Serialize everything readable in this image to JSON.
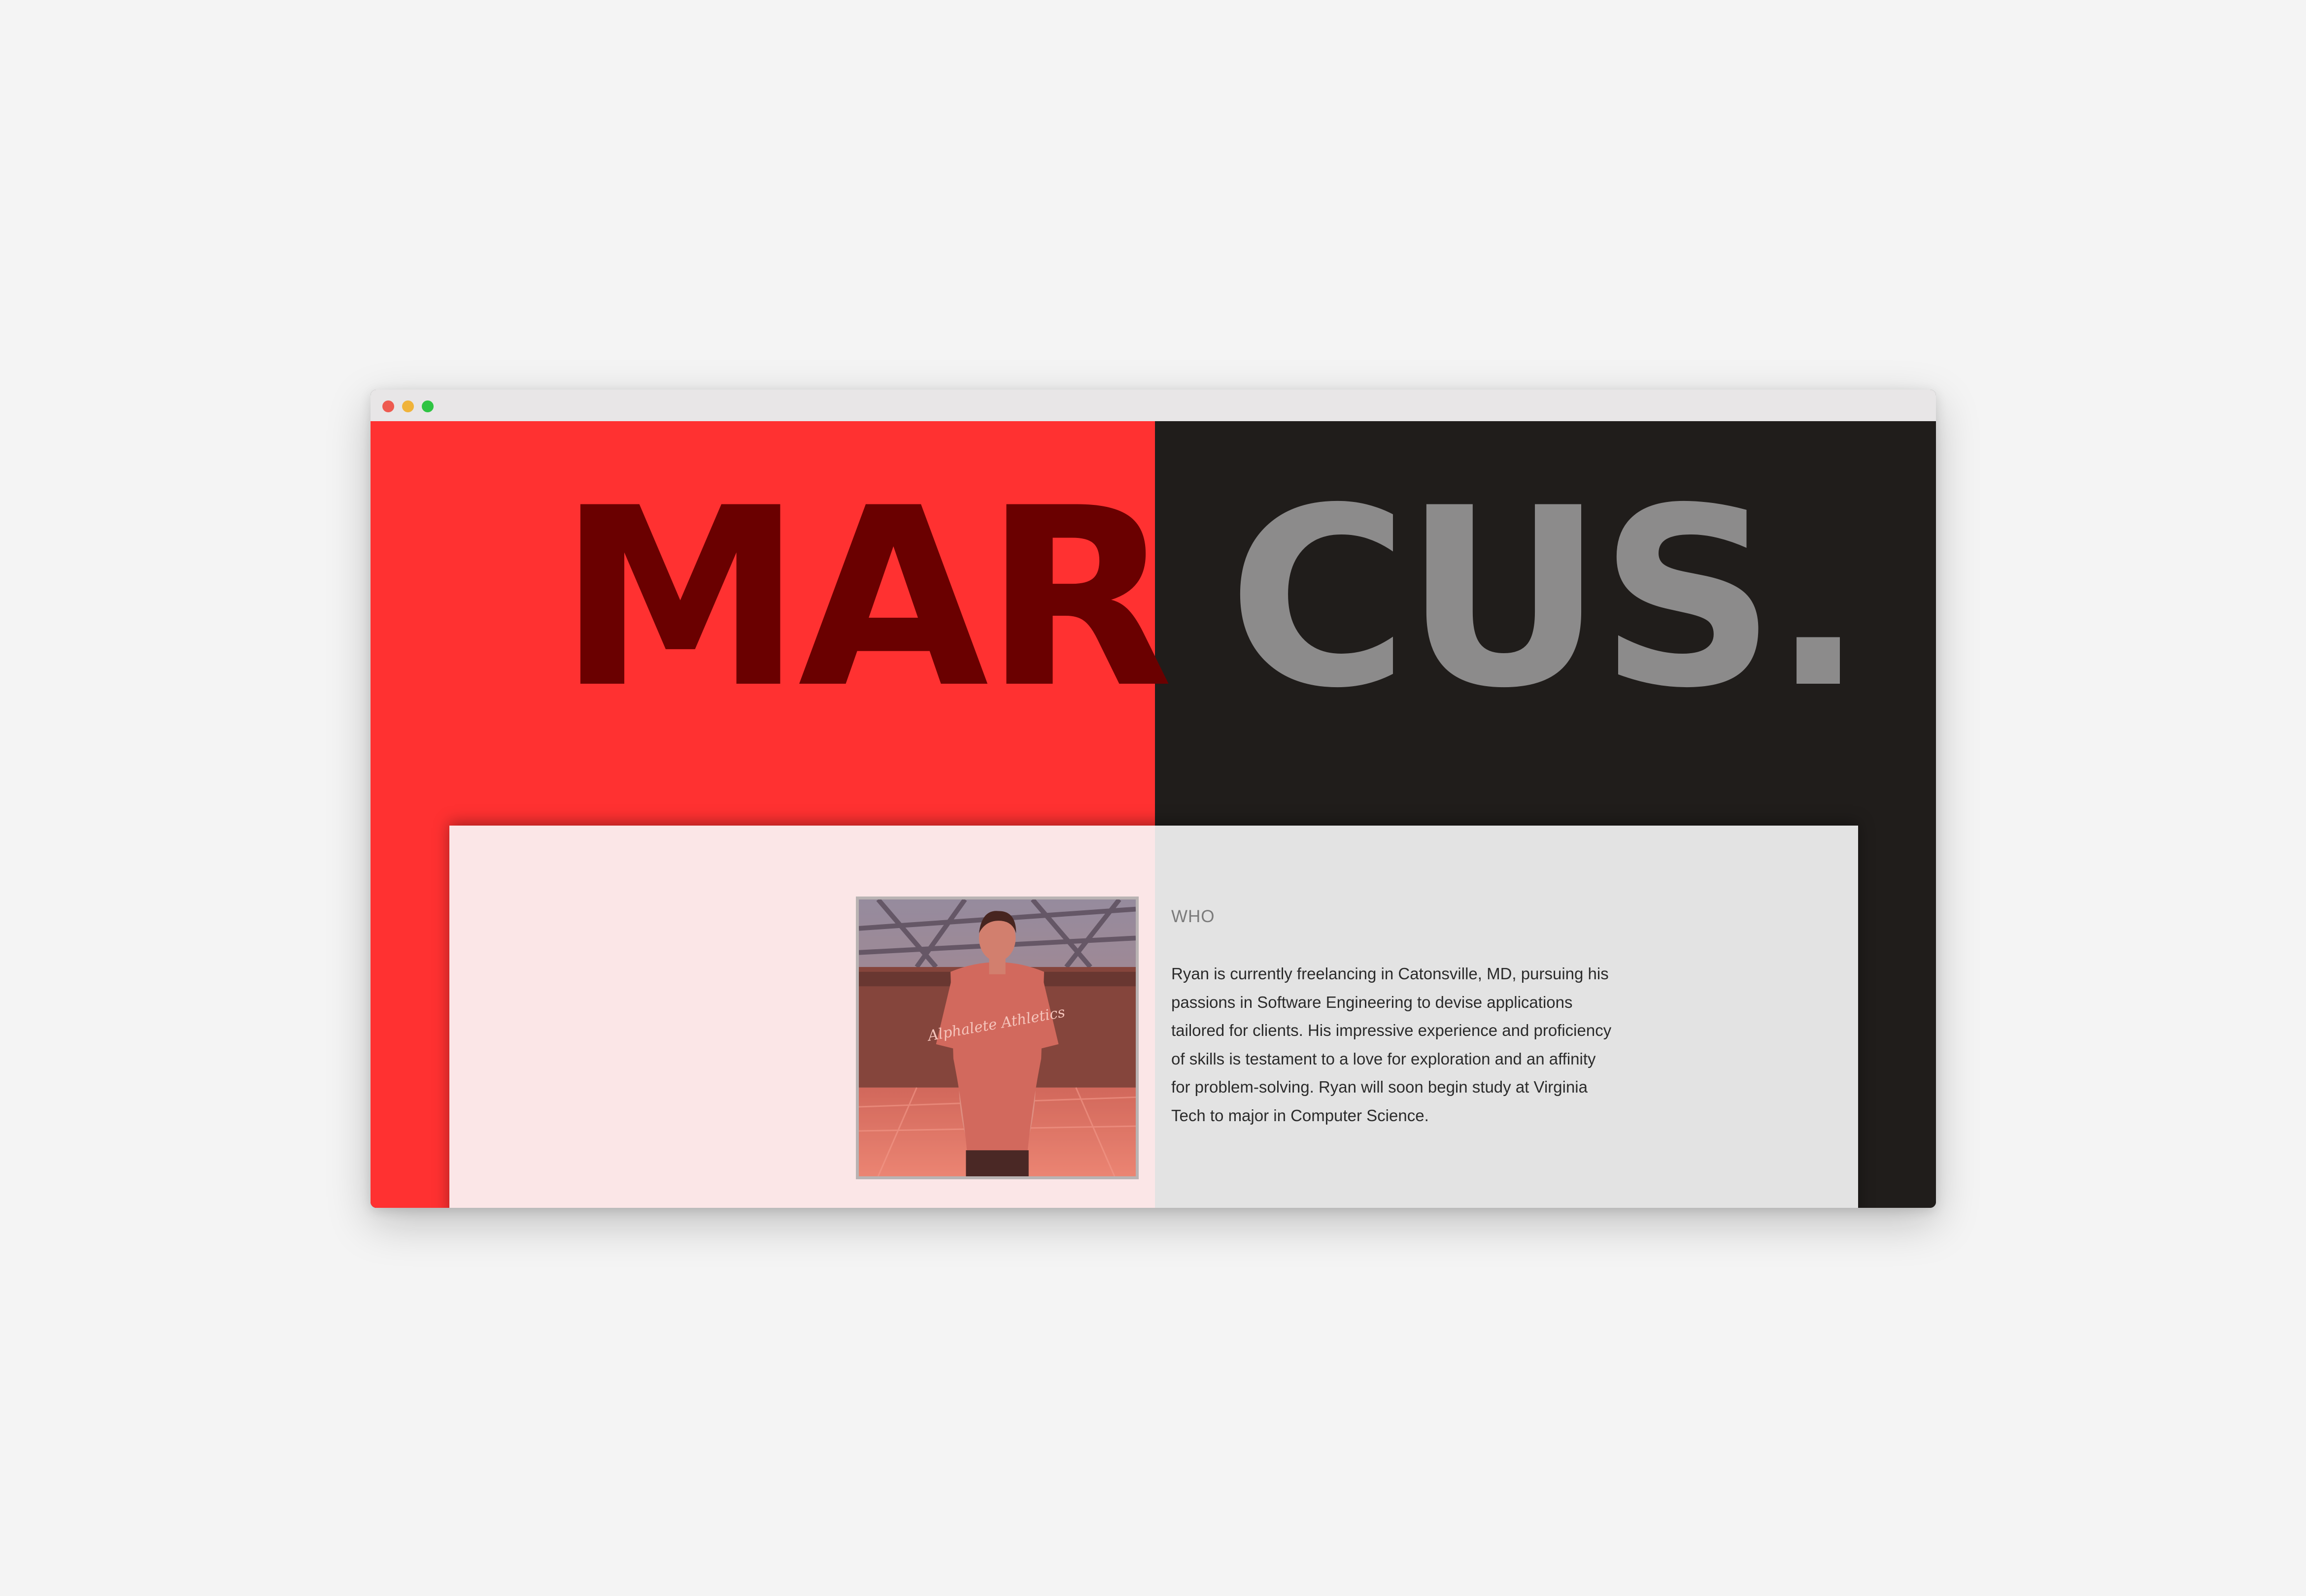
{
  "hero": {
    "left_word": "MAR",
    "right_word": "CUS."
  },
  "about": {
    "heading": "WHO",
    "photo_alt": "Portrait of Ryan wearing an Alphalete Athletics t-shirt",
    "photo_shirt_text": "Alphalete Athletics",
    "bio": "Ryan is currently freelancing in Catonsville, MD, pursuing his passions in Software Engineering to devise applications tailored for clients. His impressive experience and proficiency of skills is testament to a love for exploration and an affinity for problem-solving. Ryan will soon begin study at Virginia Tech to major in Computer Science."
  },
  "colors": {
    "accent_red": "#ff3131",
    "dark_red_text": "#6a0000",
    "dark_panel": "#201d1b",
    "gray_text": "#8c8b8b",
    "card_pink": "#fbe6e7",
    "card_gray": "#e3e3e3"
  }
}
